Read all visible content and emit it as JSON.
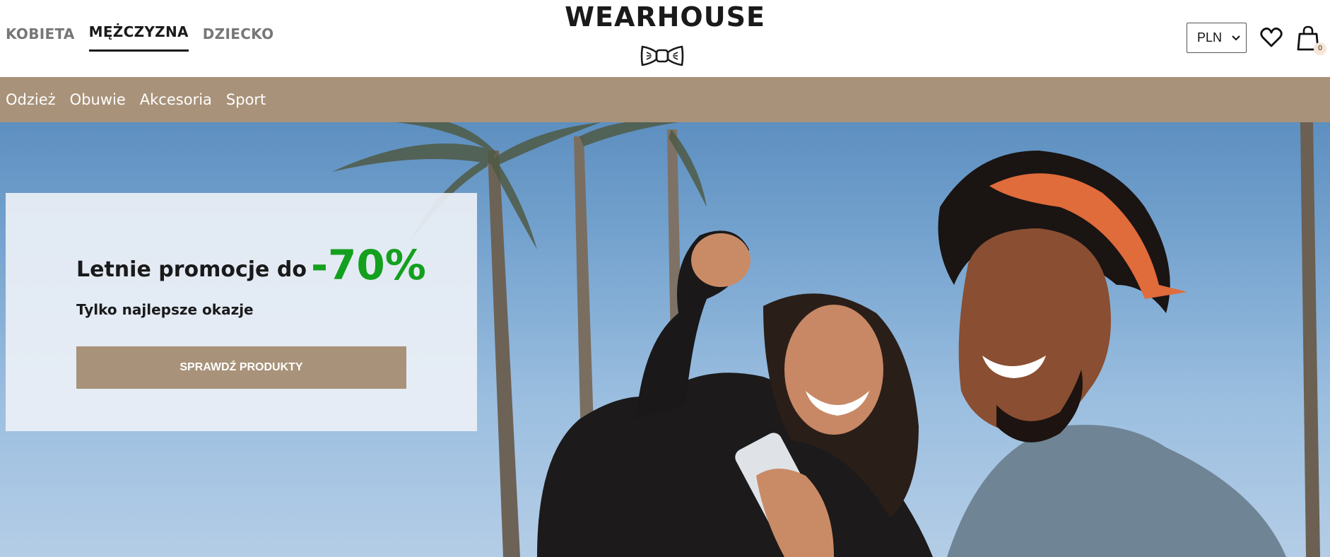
{
  "header": {
    "gender_tabs": [
      {
        "label": "KOBIETA",
        "active": false
      },
      {
        "label": "MĘŻCZYZNA",
        "active": true
      },
      {
        "label": "DZIECKO",
        "active": false
      }
    ],
    "logo_text": "WEARHOUSE",
    "currency_selected": "PLN",
    "cart_count": "0"
  },
  "categories": [
    "Odzież",
    "Obuwie",
    "Akcesoria",
    "Sport"
  ],
  "hero": {
    "promo_title": "Letnie promocje do",
    "promo_discount": "-70%",
    "promo_subtitle": "Tylko najlepsze okazje",
    "cta_label": "SPRAWDŹ PRODUKTY"
  },
  "colors": {
    "accent": "#a89279",
    "discount": "#14a01e",
    "text": "#1a1a1a"
  },
  "icons": [
    "bowtie-logo-icon",
    "heart-icon",
    "shopping-bag-icon",
    "chevron-down-icon"
  ]
}
